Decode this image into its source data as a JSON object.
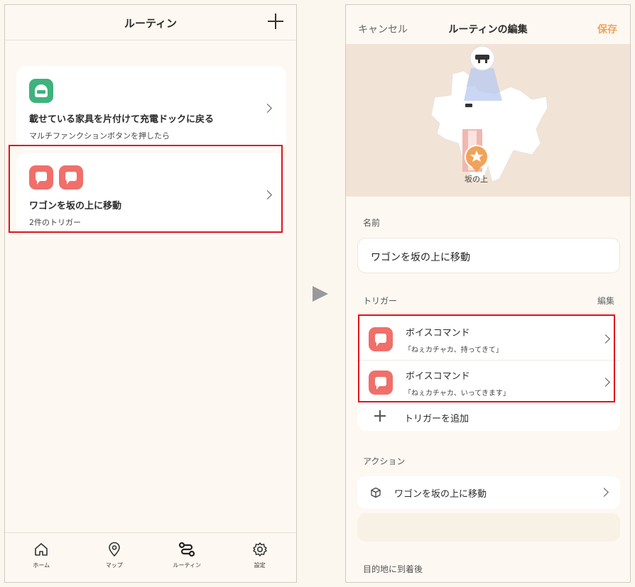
{
  "left_screen": {
    "header": {
      "title": "ルーティン"
    },
    "routines": [
      {
        "title": "載せている家具を片付けて充電ドックに戻る",
        "subtitle": "マルチファンクションボタンを押したら",
        "icon": "charging-dock-icon"
      },
      {
        "title": "ワゴンを坂の上に移動",
        "subtitle": "2件のトリガー",
        "icon": "chat-bubble-icon"
      }
    ],
    "tabbar": [
      {
        "label": "ホーム",
        "icon": "home-icon"
      },
      {
        "label": "マップ",
        "icon": "map-pin-icon"
      },
      {
        "label": "ルーティン",
        "icon": "routine-icon"
      },
      {
        "label": "設定",
        "icon": "gear-icon"
      }
    ]
  },
  "right_screen": {
    "header": {
      "cancel_label": "キャンセル",
      "title": "ルーティンの編集",
      "save_label": "保存"
    },
    "map": {
      "location_label": "坂の上"
    },
    "name_section": {
      "label": "名前",
      "value": "ワゴンを坂の上に移動"
    },
    "trigger_section": {
      "label": "トリガー",
      "edit_label": "編集",
      "triggers": [
        {
          "name": "ボイスコマンド",
          "phrase": "「ねぇカチャカ、持ってきて」"
        },
        {
          "name": "ボイスコマンド",
          "phrase": "「ねぇカチャカ、いってきます」"
        }
      ],
      "add_label": "トリガーを追加"
    },
    "action_section": {
      "label": "アクション",
      "action": "ワゴンを坂の上に移動"
    },
    "arrival_section": {
      "label": "目的地に到着後"
    }
  },
  "colors": {
    "accent_orange": "#f0a35a",
    "trigger_red": "#f06f6a",
    "dock_green": "#3fb27d",
    "highlight_red": "#e0131a"
  }
}
